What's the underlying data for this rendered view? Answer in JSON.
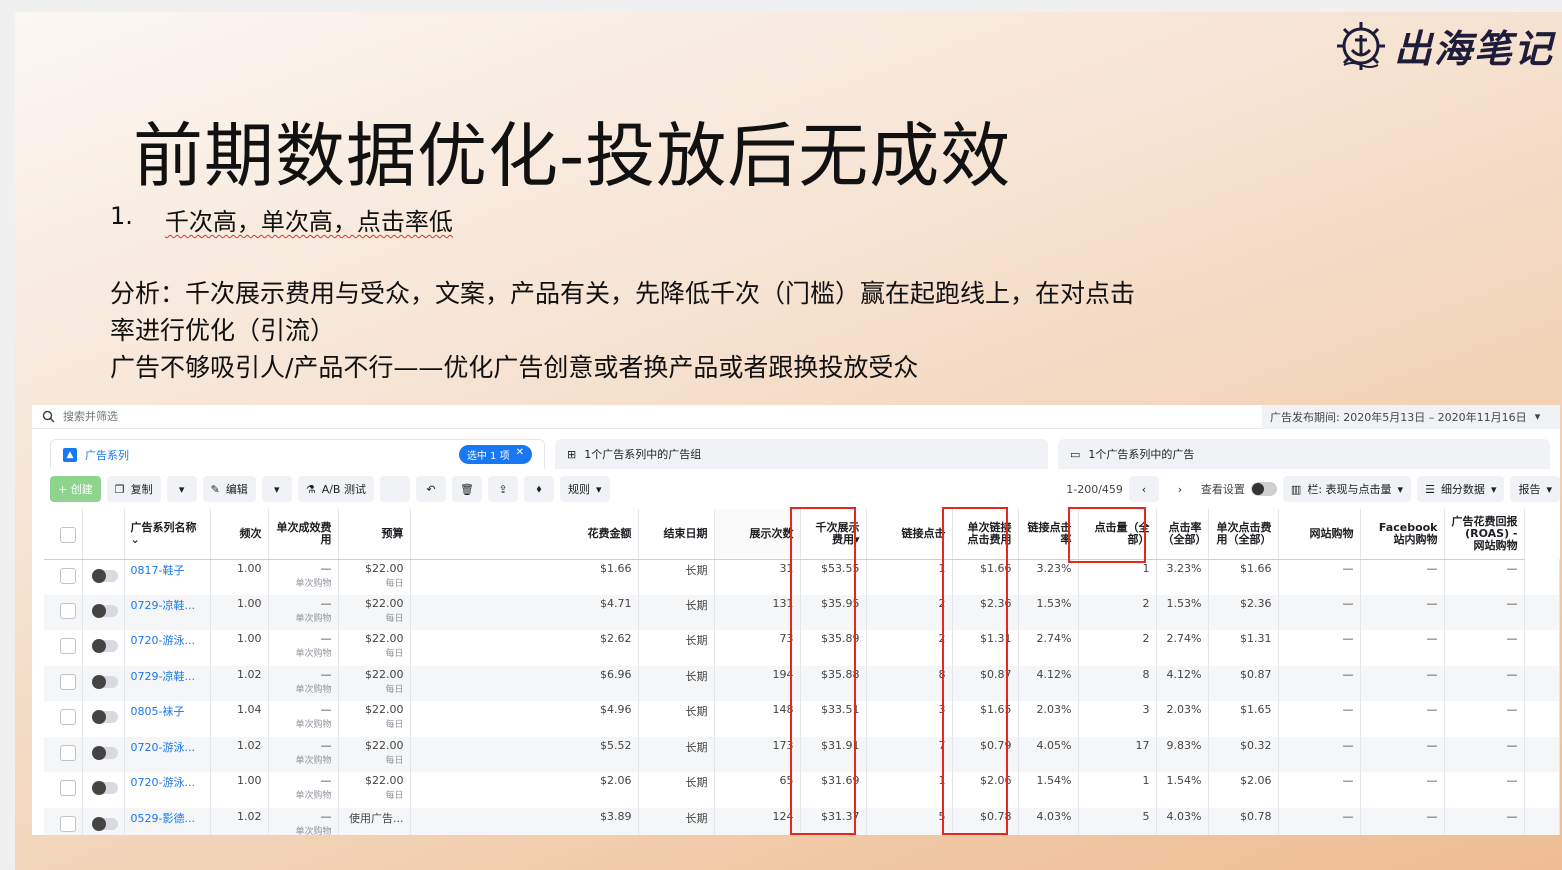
{
  "slide": {
    "title": "前期数据优化-投放后无成效",
    "logo_text": "出海笔记",
    "point": {
      "num": "1.",
      "text": "千次高，单次高，点击率低"
    },
    "analysis": [
      "分析：千次展示费用与受众，文案，产品有关，先降低千次（门槛）赢在起跑线上，在对点击",
      "率进行优化（引流）",
      "广告不够吸引人/产品不行——优化广告创意或者换产品或者跟换投放受众"
    ]
  },
  "ads_ui": {
    "search": {
      "placeholder": "搜索并筛选"
    },
    "date_range": "广告发布期间: 2020年5月13日 – 2020年11月16日",
    "tabs": [
      {
        "label": "广告系列",
        "chip": "选中 1 项"
      },
      {
        "label": "1个广告系列中的广告组"
      },
      {
        "label": "1个广告系列中的广告"
      }
    ],
    "toolbar": {
      "create": "+ 创建",
      "copy": "复制",
      "edit": "编辑",
      "ab_test": "A/B 测试",
      "rules": "规则",
      "pagination": "1-200/459",
      "view_settings": "查看设置",
      "columns": "栏: 表现与点击量",
      "breakdown": "细分数据",
      "reports": "报告"
    },
    "columns": [
      "广告系列名称",
      "频次",
      "单次成效费用",
      "预算",
      "花费金额",
      "结束日期",
      "展示次数",
      "千次展示费用",
      "链接点击",
      "单次链接点击费用",
      "链接点击率",
      "点击量（全部）",
      "点击率（全部）",
      "单次点击费用（全部）",
      "网站购物",
      "Facebook 站内购物",
      "广告花费回报 (ROAS) - 网站购物"
    ],
    "rows": [
      {
        "name": "0817-鞋子",
        "freq": "1.00",
        "cpr": "—",
        "cpr_sub": "单次购物",
        "budget": "$22.00",
        "budget_sub": "每日",
        "spend": "$1.66",
        "end": "长期",
        "impr": "31",
        "cpm": "$53.55",
        "clicks": "1",
        "cpc": "$1.66",
        "ctr": "3.23%",
        "all_clicks": "1",
        "all_ctr": "3.23%",
        "all_cpc": "$1.66",
        "purch": "—",
        "fb_purch": "—",
        "roas": "—"
      },
      {
        "name": "0729-凉鞋...",
        "freq": "1.00",
        "cpr": "—",
        "cpr_sub": "单次购物",
        "budget": "$22.00",
        "budget_sub": "每日",
        "spend": "$4.71",
        "end": "长期",
        "impr": "131",
        "cpm": "$35.95",
        "clicks": "2",
        "cpc": "$2.36",
        "ctr": "1.53%",
        "all_clicks": "2",
        "all_ctr": "1.53%",
        "all_cpc": "$2.36",
        "purch": "—",
        "fb_purch": "—",
        "roas": "—"
      },
      {
        "name": "0720-游泳...",
        "freq": "1.00",
        "cpr": "—",
        "cpr_sub": "单次购物",
        "budget": "$22.00",
        "budget_sub": "每日",
        "spend": "$2.62",
        "end": "长期",
        "impr": "73",
        "cpm": "$35.89",
        "clicks": "2",
        "cpc": "$1.31",
        "ctr": "2.74%",
        "all_clicks": "2",
        "all_ctr": "2.74%",
        "all_cpc": "$1.31",
        "purch": "—",
        "fb_purch": "—",
        "roas": "—"
      },
      {
        "name": "0729-凉鞋...",
        "freq": "1.02",
        "cpr": "—",
        "cpr_sub": "单次购物",
        "budget": "$22.00",
        "budget_sub": "每日",
        "spend": "$6.96",
        "end": "长期",
        "impr": "194",
        "cpm": "$35.88",
        "clicks": "8",
        "cpc": "$0.87",
        "ctr": "4.12%",
        "all_clicks": "8",
        "all_ctr": "4.12%",
        "all_cpc": "$0.87",
        "purch": "—",
        "fb_purch": "—",
        "roas": "—"
      },
      {
        "name": "0805-袜子",
        "freq": "1.04",
        "cpr": "—",
        "cpr_sub": "单次购物",
        "budget": "$22.00",
        "budget_sub": "每日",
        "spend": "$4.96",
        "end": "长期",
        "impr": "148",
        "cpm": "$33.51",
        "clicks": "3",
        "cpc": "$1.65",
        "ctr": "2.03%",
        "all_clicks": "3",
        "all_ctr": "2.03%",
        "all_cpc": "$1.65",
        "purch": "—",
        "fb_purch": "—",
        "roas": "—"
      },
      {
        "name": "0720-游泳...",
        "freq": "1.02",
        "cpr": "—",
        "cpr_sub": "单次购物",
        "budget": "$22.00",
        "budget_sub": "每日",
        "spend": "$5.52",
        "end": "长期",
        "impr": "173",
        "cpm": "$31.91",
        "clicks": "7",
        "cpc": "$0.79",
        "ctr": "4.05%",
        "all_clicks": "17",
        "all_ctr": "9.83%",
        "all_cpc": "$0.32",
        "purch": "—",
        "fb_purch": "—",
        "roas": "—"
      },
      {
        "name": "0720-游泳...",
        "freq": "1.00",
        "cpr": "—",
        "cpr_sub": "单次购物",
        "budget": "$22.00",
        "budget_sub": "每日",
        "spend": "$2.06",
        "end": "长期",
        "impr": "65",
        "cpm": "$31.69",
        "clicks": "1",
        "cpc": "$2.06",
        "ctr": "1.54%",
        "all_clicks": "1",
        "all_ctr": "1.54%",
        "all_cpc": "$2.06",
        "purch": "—",
        "fb_purch": "—",
        "roas": "—"
      },
      {
        "name": "0529-影德...",
        "freq": "1.02",
        "cpr": "—",
        "cpr_sub": "单次购物",
        "budget": "使用广告...",
        "budget_sub": "",
        "spend": "$3.89",
        "end": "长期",
        "impr": "124",
        "cpm": "$31.37",
        "clicks": "5",
        "cpc": "$0.78",
        "ctr": "4.03%",
        "all_clicks": "5",
        "all_ctr": "4.03%",
        "all_cpc": "$0.78",
        "purch": "—",
        "fb_purch": "—",
        "roas": "—"
      }
    ],
    "highlight_color": "#e0291f"
  }
}
